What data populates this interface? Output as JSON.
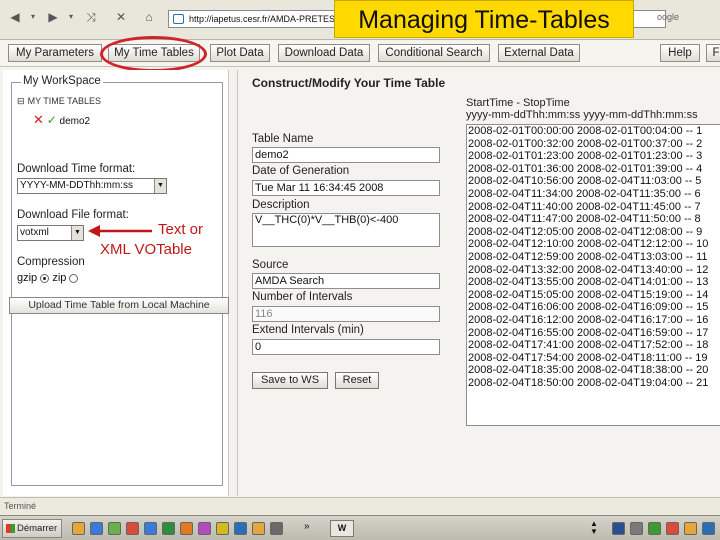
{
  "slide_title": "Managing Time-Tables",
  "browser": {
    "url": "http://iapetus.cesr.fr/AMDA-PRETEST",
    "search_hint": "oogle"
  },
  "tabs": [
    {
      "label": "My Parameters"
    },
    {
      "label": "My Time Tables"
    },
    {
      "label": "Plot Data"
    },
    {
      "label": "Download Data"
    },
    {
      "label": "Conditional Search"
    },
    {
      "label": "External Data"
    },
    {
      "label": "Help"
    },
    {
      "label": "F"
    }
  ],
  "workspace": {
    "legend": "My WorkSpace",
    "tree_root": "MY TIME TABLES",
    "tree_item": "demo2",
    "time_format_label": "Download Time format:",
    "time_format_value": "YYYY-MM-DDThh:mm:ss",
    "file_format_label": "Download File format:",
    "file_format_value": "votxml",
    "compression_label": "Compression",
    "gzip_label": "gzip",
    "zip_label": "zip",
    "upload_label": "Upload Time Table from Local Machine"
  },
  "annotation": {
    "line1": "Text or",
    "line2": "XML VOTable"
  },
  "construct": {
    "title": "Construct/Modify Your Time Table",
    "name_label": "Table Name",
    "name_value": "demo2",
    "gen_label": "Date of Generation",
    "gen_value": "Tue Mar 11 16:34:45 2008",
    "desc_label": "Description",
    "desc_value": "V__THC(0)*V__THB(0)<-400",
    "source_label": "Source",
    "source_value": "AMDA Search",
    "count_label": "Number of Intervals",
    "count_value": "116",
    "extend_label": "Extend Intervals (min)",
    "extend_value": "0",
    "save_label": "Save to WS",
    "reset_label": "Reset",
    "intervals_header_1": "StartTime - StopTime",
    "intervals_header_2": "yyyy-mm-ddThh:mm:ss yyyy-mm-ddThh:mm:ss",
    "intervals": [
      "2008-02-01T00:00:00 2008-02-01T00:04:00 -- 1",
      "2008-02-01T00:32:00 2008-02-01T00:37:00 -- 2",
      "2008-02-01T01:23:00 2008-02-01T01:23:00 -- 3",
      "2008-02-01T01:36:00 2008-02-01T01:39:00 -- 4",
      "2008-02-04T10:56:00 2008-02-04T11:03:00 -- 5",
      "2008-02-04T11:34:00 2008-02-04T11:35:00 -- 6",
      "2008-02-04T11:40:00 2008-02-04T11:45:00 -- 7",
      "2008-02-04T11:47:00 2008-02-04T11:50:00 -- 8",
      "2008-02-04T12:05:00 2008-02-04T12:08:00 -- 9",
      "2008-02-04T12:10:00 2008-02-04T12:12:00 -- 10",
      "2008-02-04T12:59:00 2008-02-04T13:03:00 -- 11",
      "2008-02-04T13:32:00 2008-02-04T13:40:00 -- 12",
      "2008-02-04T13:55:00 2008-02-04T14:01:00 -- 13",
      "2008-02-04T15:05:00 2008-02-04T15:19:00 -- 14",
      "2008-02-04T16:06:00 2008-02-04T16:09:00 -- 15",
      "2008-02-04T16:12:00 2008-02-04T16:17:00 -- 16",
      "2008-02-04T16:55:00 2008-02-04T16:59:00 -- 17",
      "2008-02-04T17:41:00 2008-02-04T17:52:00 -- 18",
      "2008-02-04T17:54:00 2008-02-04T18:11:00 -- 19",
      "2008-02-04T18:35:00 2008-02-04T18:38:00 -- 20",
      "2008-02-04T18:50:00 2008-02-04T19:04:00 -- 21"
    ]
  },
  "status_text": "Terminé",
  "taskbar": {
    "start_label": "Démarrer",
    "task_label": "W"
  }
}
